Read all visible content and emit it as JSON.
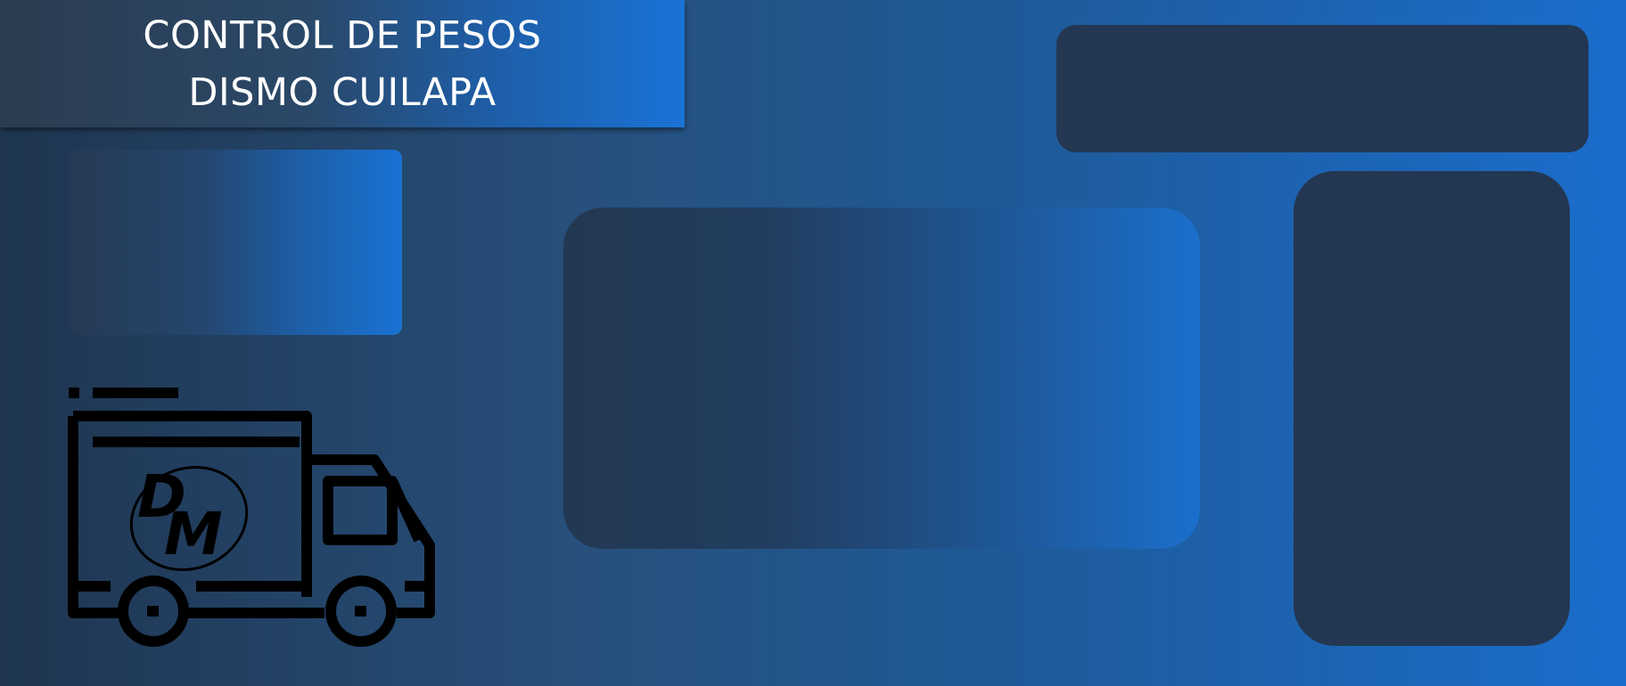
{
  "header": {
    "title_line1": "CONTROL DE PESOS",
    "title_line2": "DISMO CUILAPA"
  },
  "logo": {
    "letter_d": "D",
    "letter_m": "M",
    "icon": "delivery-truck-icon"
  },
  "colors": {
    "background_start": "#1f3550",
    "background_end": "#1b6dcc",
    "panel_dark": "#233752",
    "title_text": "#ffffff"
  }
}
